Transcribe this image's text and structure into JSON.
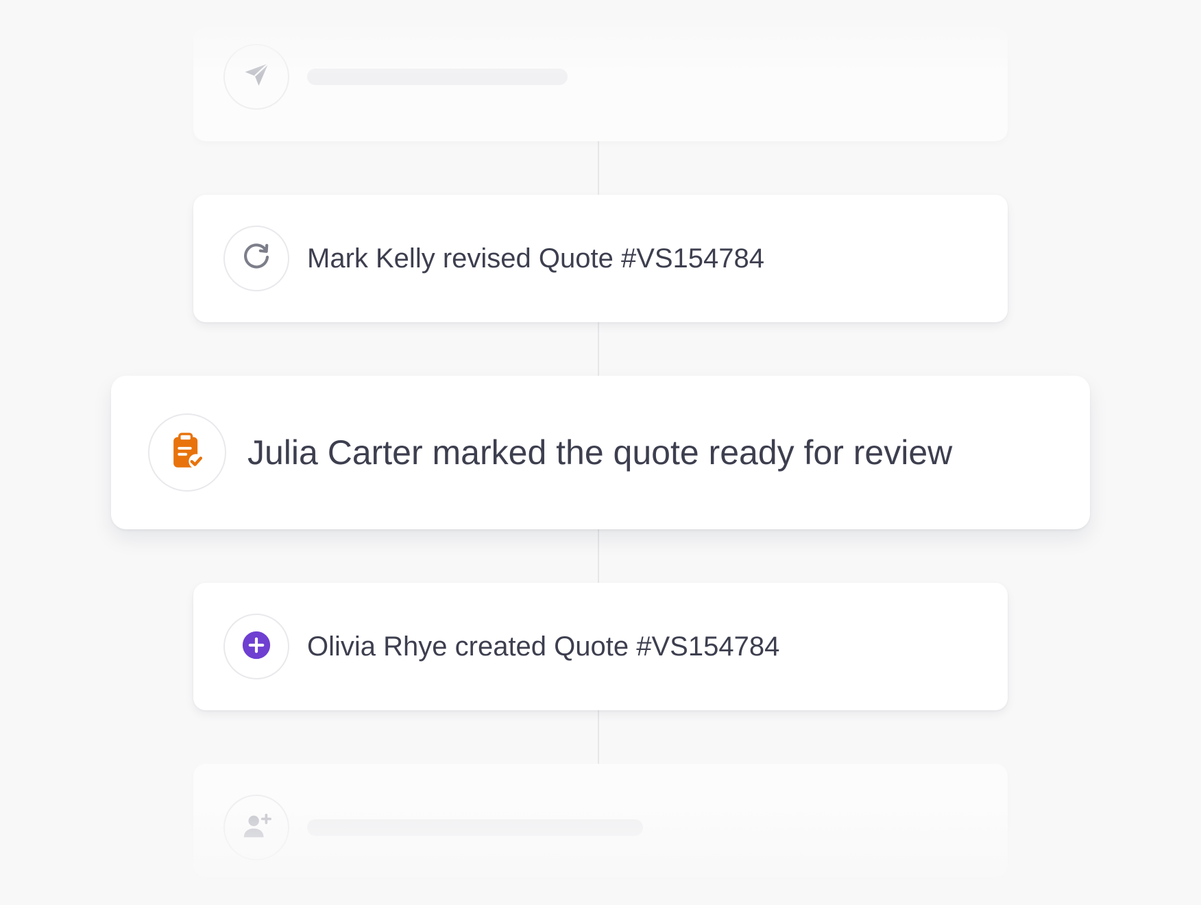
{
  "timeline": {
    "entries": [
      {
        "icon": "send-icon",
        "text": "",
        "state": "placeholder"
      },
      {
        "icon": "refresh-icon",
        "text": "Mark Kelly revised Quote #VS154784",
        "state": "normal"
      },
      {
        "icon": "clipboard-check-icon",
        "text": "Julia Carter marked the quote ready for review",
        "state": "featured"
      },
      {
        "icon": "plus-circle-icon",
        "text": "Olivia Rhye created Quote #VS154784",
        "state": "normal"
      },
      {
        "icon": "user-plus-icon",
        "text": "",
        "state": "placeholder"
      }
    ]
  },
  "colors": {
    "background": "#f8f8f9",
    "card": "#ffffff",
    "text": "#3d3f4f",
    "icon_ring": "#e9e9ed",
    "accent_orange": "#e8730c",
    "accent_purple": "#6e3fd1",
    "muted_icon": "#a7a8b0"
  }
}
